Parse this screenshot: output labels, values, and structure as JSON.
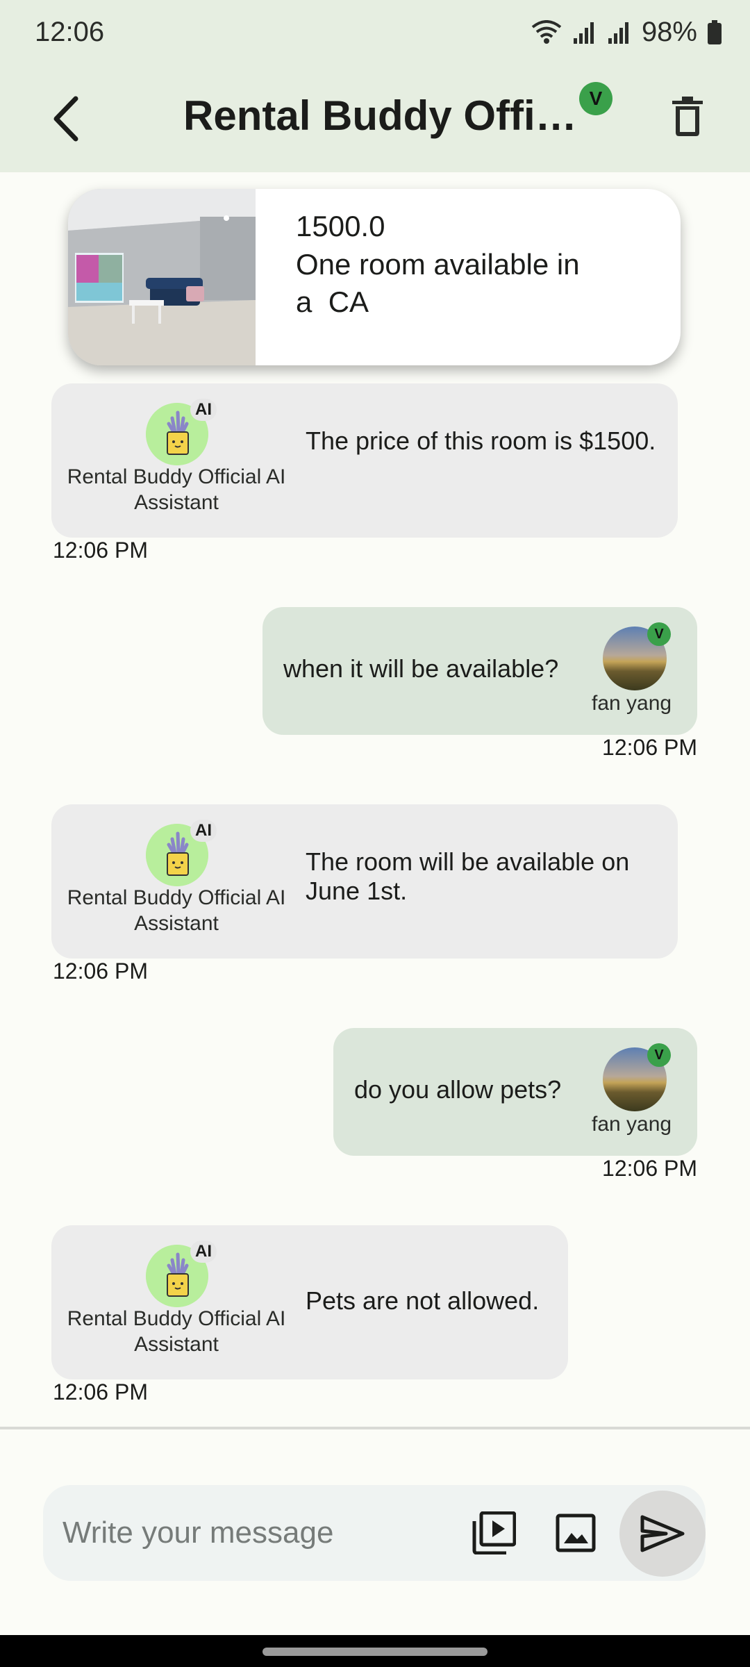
{
  "status_bar": {
    "time": "12:06",
    "battery_text": "98%"
  },
  "header": {
    "title": "Rental Buddy Offici…",
    "verified_badge": "V"
  },
  "listing": {
    "price": "1500.0",
    "title": "One room available in a  CA"
  },
  "messages": [
    {
      "sender": "bot",
      "name": "Rental Buddy Official AI Assistant",
      "ai_tag": "AI",
      "text": "The price of this room is $1500.",
      "time": "12:06 PM"
    },
    {
      "sender": "user",
      "name": "fan yang",
      "badge": "V",
      "text": "when it will be available?",
      "time": "12:06 PM"
    },
    {
      "sender": "bot",
      "name": "Rental Buddy Official AI Assistant",
      "ai_tag": "AI",
      "text": "The room will be available on June 1st.",
      "time": "12:06 PM"
    },
    {
      "sender": "user",
      "name": "fan yang",
      "badge": "V",
      "text": "do you allow pets?",
      "time": "12:06 PM"
    },
    {
      "sender": "bot",
      "name": "Rental Buddy Official AI Assistant",
      "ai_tag": "AI",
      "text": "Pets are not allowed.",
      "time": "12:06 PM"
    }
  ],
  "composer": {
    "placeholder": "Write your message"
  },
  "icons": {
    "back": "chevron-left-icon",
    "delete": "trash-icon",
    "video": "video-library-icon",
    "image": "image-icon",
    "send": "send-icon"
  },
  "colors": {
    "header_bg": "#e6eee1",
    "bot_bubble": "#ececec",
    "user_bubble": "#dbe6da",
    "verified_green": "#3aa04a",
    "bot_avatar": "#b8ee9c"
  }
}
